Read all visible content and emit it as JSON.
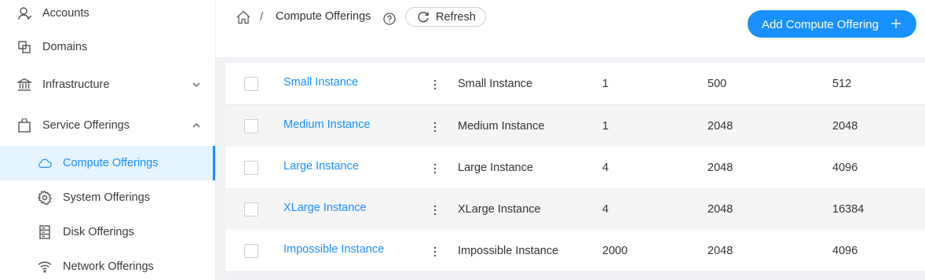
{
  "sidebar": {
    "items": [
      {
        "label": "Accounts",
        "icon": "user-icon"
      },
      {
        "label": "Domains",
        "icon": "domains-icon"
      },
      {
        "label": "Infrastructure",
        "icon": "bank-icon",
        "arrow": "down"
      },
      {
        "label": "Service Offerings",
        "icon": "bag-icon",
        "arrow": "up"
      },
      {
        "label": "Compute Offerings",
        "icon": "cloud-icon",
        "active": true
      },
      {
        "label": "System Offerings",
        "icon": "gear-icon"
      },
      {
        "label": "Disk Offerings",
        "icon": "hdd-icon"
      },
      {
        "label": "Network Offerings",
        "icon": "wifi-icon"
      }
    ]
  },
  "header": {
    "breadcrumb_sep": "/",
    "title": "Compute Offerings",
    "refresh_label": "Refresh",
    "add_label": "Add Compute Offering"
  },
  "table": {
    "rows": [
      {
        "name": "Small Instance",
        "description": "Small Instance",
        "cpu": "1",
        "speed": "500",
        "memory": "512"
      },
      {
        "name": "Medium Instance",
        "description": "Medium Instance",
        "cpu": "1",
        "speed": "2048",
        "memory": "2048"
      },
      {
        "name": "Large Instance",
        "description": "Large Instance",
        "cpu": "4",
        "speed": "2048",
        "memory": "4096"
      },
      {
        "name": "XLarge Instance",
        "description": "XLarge Instance",
        "cpu": "4",
        "speed": "2048",
        "memory": "16384"
      },
      {
        "name": "Impossible Instance",
        "description": "Impossible Instance",
        "cpu": "2000",
        "speed": "2048",
        "memory": "4096"
      }
    ]
  },
  "colors": {
    "accent": "#1890ff",
    "active_bg": "#e6f4ff",
    "row_alt": "#f5f5f5"
  }
}
